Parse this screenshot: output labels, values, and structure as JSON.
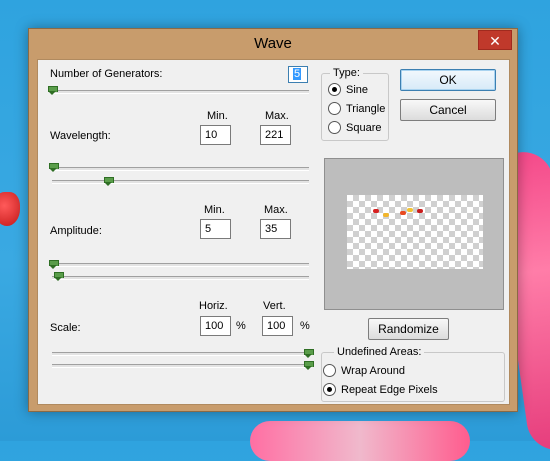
{
  "window": {
    "title": "Wave",
    "close_glyph": "✕"
  },
  "generators": {
    "label": "Number of Generators:",
    "value": "5"
  },
  "columns": {
    "min": "Min.",
    "max": "Max.",
    "horiz": "Horiz.",
    "vert": "Vert."
  },
  "wavelength": {
    "label": "Wavelength:",
    "min": "10",
    "max": "221"
  },
  "amplitude": {
    "label": "Amplitude:",
    "min": "5",
    "max": "35"
  },
  "scale": {
    "label": "Scale:",
    "horiz": "100",
    "vert": "100",
    "unit": "%"
  },
  "type_group": {
    "legend": "Type:",
    "options": [
      "Sine",
      "Triangle",
      "Square"
    ],
    "selected": "Sine"
  },
  "buttons": {
    "ok": "OK",
    "cancel": "Cancel",
    "randomize": "Randomize"
  },
  "undefined_areas": {
    "legend": "Undefined Areas:",
    "options": [
      "Wrap Around",
      "Repeat Edge Pixels"
    ],
    "selected": "Repeat Edge Pixels"
  },
  "colors": {
    "titlebar": "#c89c6c",
    "close_button": "#c0392b",
    "slider_thumb": "#5a9d4a",
    "desktop": "#2fa3df"
  }
}
